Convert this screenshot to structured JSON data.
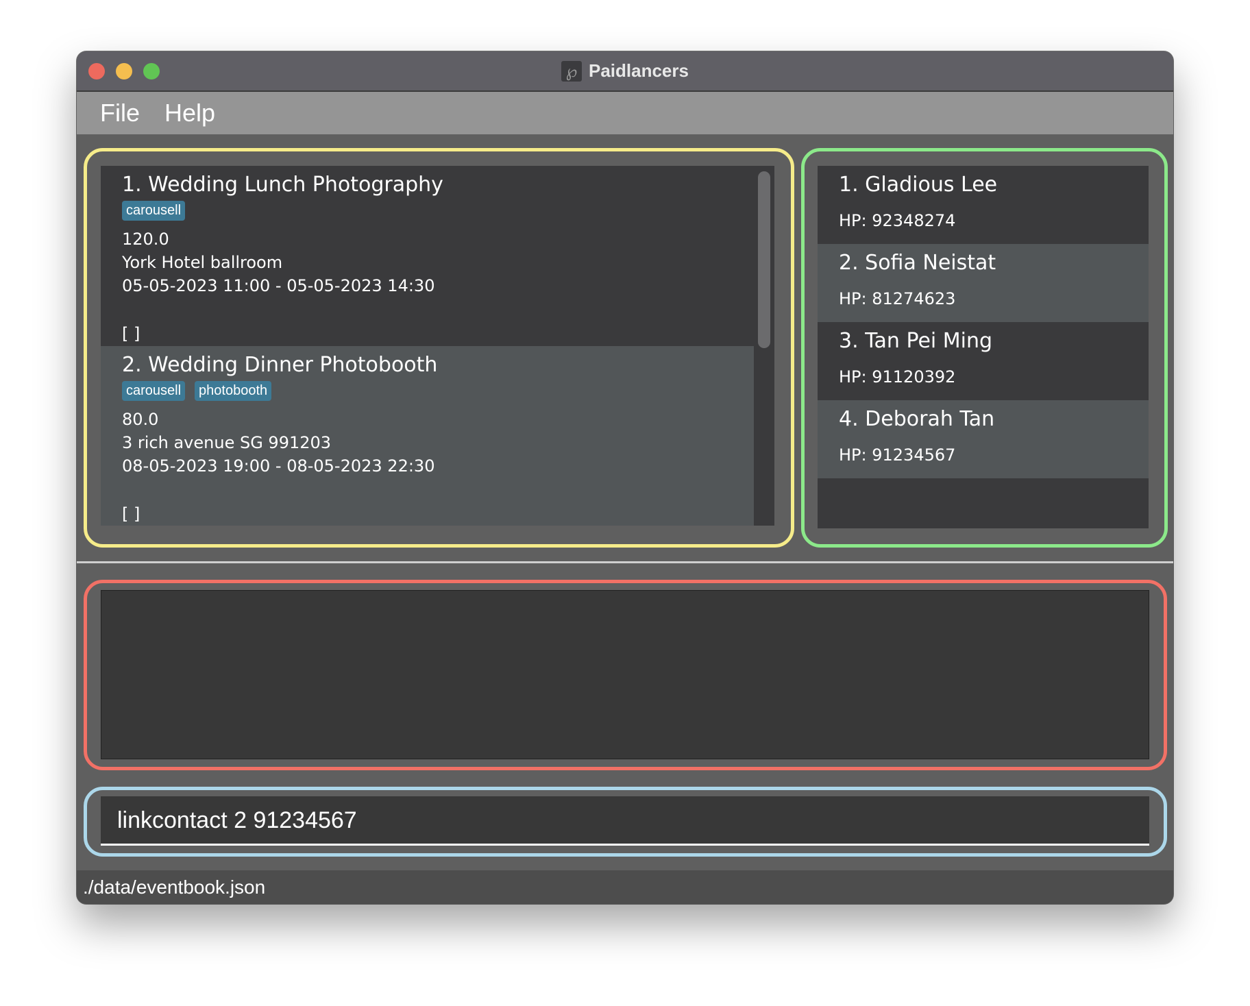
{
  "window": {
    "title": "Paidlancers",
    "icon": "paidlancers-logo-icon",
    "icon_glyph": "℘"
  },
  "menu": {
    "file_label": "File",
    "help_label": "Help"
  },
  "events": [
    {
      "title": "1.  Wedding Lunch Photography",
      "tags": [
        "carousell"
      ],
      "price": "120.0",
      "venue": "York Hotel ballroom",
      "time": "05-05-2023 11:00 - 05-05-2023 14:30",
      "extra": "[ ]"
    },
    {
      "title": "2.  Wedding Dinner Photobooth",
      "tags": [
        "carousell",
        "photobooth"
      ],
      "price": "80.0",
      "venue": "3 rich avenue SG 991203",
      "time": "08-05-2023 19:00 - 08-05-2023 22:30",
      "extra": "[ ]"
    }
  ],
  "contacts": [
    {
      "name": "1. Gladious Lee",
      "phone": "HP: 92348274"
    },
    {
      "name": "2. Sofia Neistat",
      "phone": "HP: 81274623"
    },
    {
      "name": "3. Tan Pei Ming",
      "phone": "HP: 91120392"
    },
    {
      "name": "4. Deborah Tan",
      "phone": "HP: 91234567"
    }
  ],
  "result": {
    "text": ""
  },
  "command": {
    "value": "linkcontact 2 91234567"
  },
  "status": {
    "path": "./data/eventbook.json"
  },
  "colors": {
    "event_panel_outline": "#f6ec8a",
    "contact_panel_outline": "#8ce98a",
    "result_panel_outline": "#f27166",
    "command_panel_outline": "#acd7ea",
    "tag_background": "#3d7a96"
  }
}
